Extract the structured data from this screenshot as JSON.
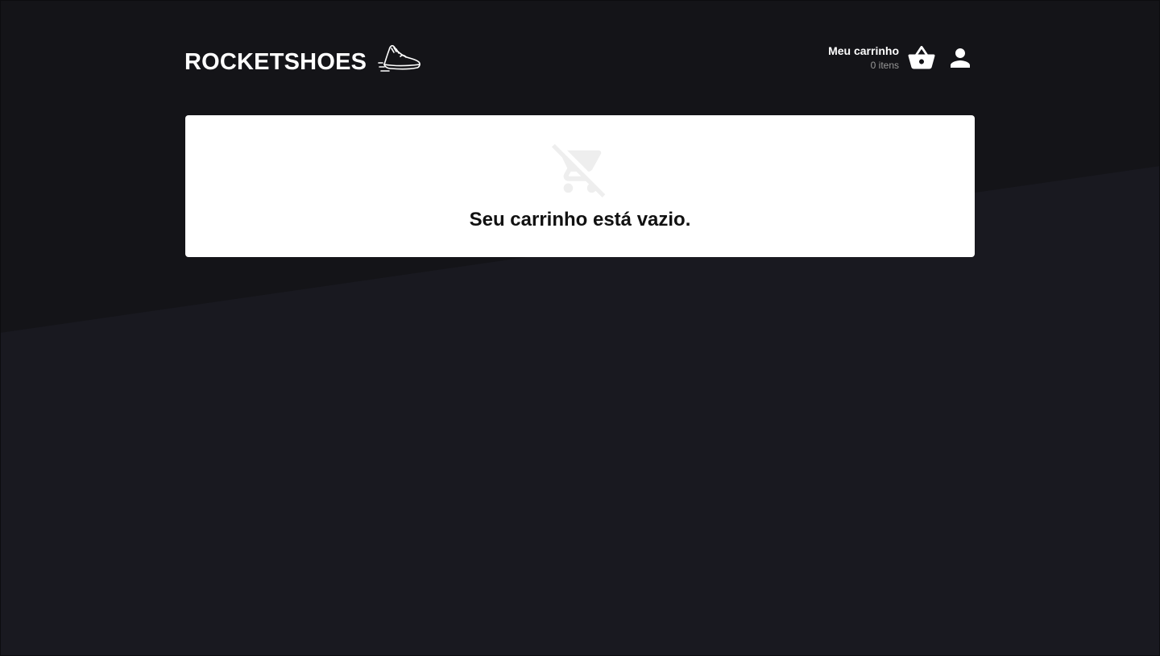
{
  "header": {
    "logo_text": "ROCKETSHOES",
    "logo_icon": "running-shoe-icon",
    "cart_label": "Meu carrinho",
    "cart_count": "0 itens",
    "cart_icon": "basket-icon",
    "user_icon": "user-icon"
  },
  "cart": {
    "empty_icon": "remove-shopping-cart-icon",
    "empty_message": "Seu carrinho está vazio."
  },
  "colors": {
    "background_top": "#141418",
    "background_bottom": "#191920",
    "card": "#ffffff",
    "text_primary": "#ffffff",
    "text_muted": "#999999",
    "empty_icon": "#eeeeee"
  }
}
